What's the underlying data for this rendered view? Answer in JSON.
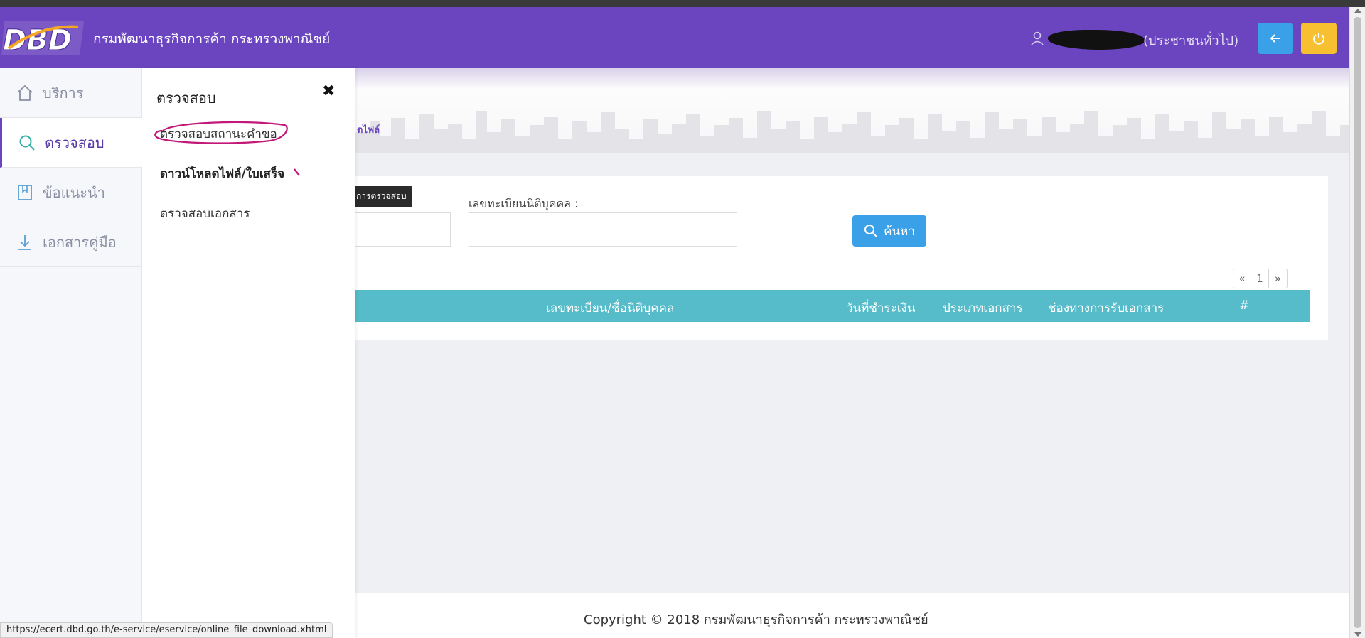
{
  "header": {
    "site_title": "กรมพัฒนาธุรกิจการค้า กระทรวงพาณิชย์",
    "logo_text": "DBD",
    "user_role": "(ประชาชนทั่วไป)",
    "back_icon": "arrow-left-icon",
    "power_icon": "power-icon"
  },
  "sidebar": {
    "items": [
      {
        "label": "บริการ",
        "icon": "home-icon"
      },
      {
        "label": "ตรวจสอบ",
        "icon": "search-icon"
      },
      {
        "label": "ข้อแนะนำ",
        "icon": "bookmark-icon"
      },
      {
        "label": "เอกสารคู่มือ",
        "icon": "download-icon"
      }
    ]
  },
  "submenu": {
    "title": "ตรวจสอบ",
    "close_icon": "close-icon",
    "items": [
      {
        "label": "ตรวจสอบสถานะคำขอ"
      },
      {
        "label": "ดาวน์โหลดไฟล์/ใบเสร็จ"
      },
      {
        "label": "ตรวจสอบเอกสาร"
      }
    ]
  },
  "banner": {
    "breadcrumb_fragment": "ดไฟล์"
  },
  "search_form": {
    "tooltip": "การตรวจสอบ",
    "registration_label": "เลขทะเบียนนิติบุคคล :",
    "search_button": "ค้นหา"
  },
  "pagination": {
    "prev": "«",
    "current": "1",
    "next": "»"
  },
  "table": {
    "headers": [
      "เลขทะเบียน/ชื่อนิติบุคคล",
      "วันที่ชำระเงิน",
      "ประเภทเอกสาร",
      "ช่องทางการรับเอกสาร",
      "#"
    ]
  },
  "footer": {
    "copyright": "Copyright © 2018 กรมพัฒนาธุรกิจการค้า กระทรวงพาณิชย์"
  },
  "statusbar": {
    "url": "https://ecert.dbd.go.th/e-service/eservice/online_file_download.xhtml"
  },
  "colors": {
    "header_purple": "#6a45bf",
    "table_header": "#56bcc9",
    "button_blue": "#3aa0e8",
    "button_yellow": "#f6c031"
  }
}
